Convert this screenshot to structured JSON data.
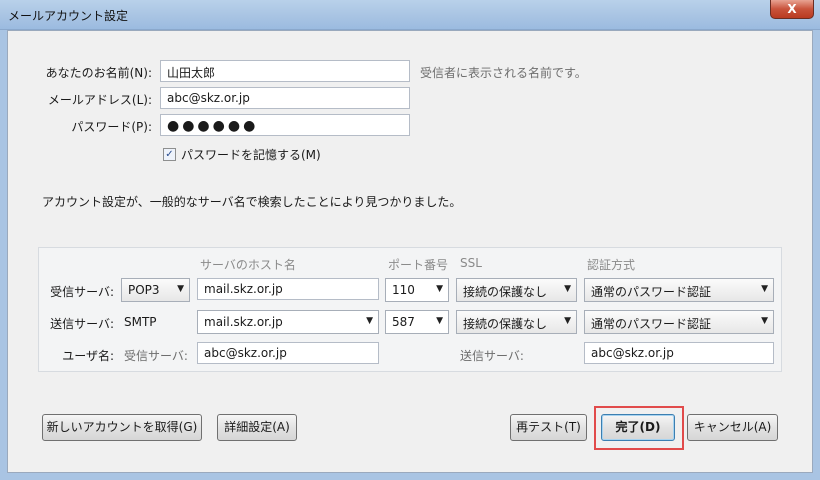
{
  "window": {
    "title": "メールアカウント設定",
    "close_label": "X"
  },
  "identity": {
    "name_label": "あなたのお名前(N):",
    "name_value": "山田太郎",
    "name_hint": "受信者に表示される名前です。",
    "email_label": "メールアドレス(L):",
    "email_value": "abc@skz.or.jp",
    "password_label": "パスワード(P):",
    "password_value": "●●●●●●",
    "remember_label": "パスワードを記憶する(M)",
    "remember_checked": true
  },
  "notice": "アカウント設定が、一般的なサーバ名で検索したことにより見つかりました。",
  "server_table": {
    "headers": {
      "host": "サーバのホスト名",
      "port": "ポート番号",
      "ssl": "SSL",
      "auth": "認証方式"
    },
    "incoming": {
      "label": "受信サーバ:",
      "protocol": "POP3",
      "host": "mail.skz.or.jp",
      "port": "110",
      "ssl": "接続の保護なし",
      "auth": "通常のパスワード認証"
    },
    "outgoing": {
      "label": "送信サーバ:",
      "protocol": "SMTP",
      "host": "mail.skz.or.jp",
      "port": "587",
      "ssl": "接続の保護なし",
      "auth": "通常のパスワード認証"
    },
    "username": {
      "label": "ユーザ名:",
      "incoming_label": "受信サーバ:",
      "incoming_value": "abc@skz.or.jp",
      "outgoing_label": "送信サーバ:",
      "outgoing_value": "abc@skz.or.jp"
    }
  },
  "buttons": {
    "new_account": "新しいアカウントを取得(G)",
    "advanced": "詳細設定(A)",
    "retest": "再テスト(T)",
    "done": "完了(D)",
    "cancel": "キャンセル(A)"
  },
  "colors": {
    "highlight": "#e14b4b",
    "title_bar": "#a9c4e3"
  }
}
